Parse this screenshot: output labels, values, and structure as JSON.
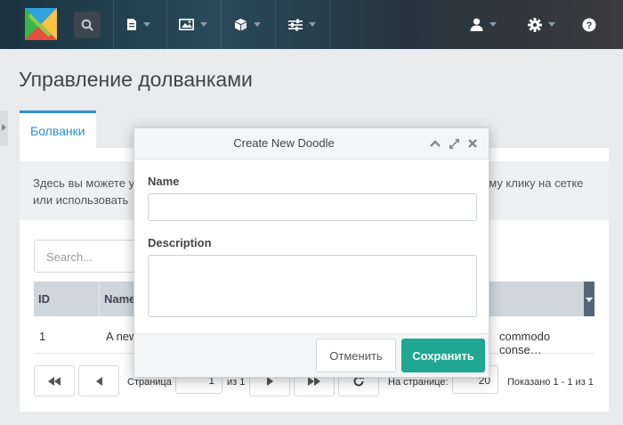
{
  "page": {
    "title": "Управление долванками"
  },
  "tabs": [
    {
      "label": "Болванки"
    }
  ],
  "info": {
    "line1_start": "Здесь вы можете у",
    "line1_end": "ому клику на сетке",
    "line2": "или использовать"
  },
  "grid": {
    "search_placeholder": "Search...",
    "columns": [
      {
        "label": "ID"
      },
      {
        "label": "Name"
      }
    ],
    "rows": [
      {
        "id": "1",
        "name": "A new",
        "tail": "commodo conse…"
      }
    ]
  },
  "pagination": {
    "page_label": "Страница",
    "page_value": "1",
    "of_label": "из 1",
    "per_page_label": "На странице:",
    "per_page_value": "20",
    "summary": "Показано 1 - 1 из 1"
  },
  "modal": {
    "title": "Create New Doodle",
    "name_label": "Name",
    "description_label": "Description",
    "cancel_label": "Отменить",
    "save_label": "Сохранить"
  },
  "colors": {
    "accent": "#2b8fd0",
    "save": "#1fa791",
    "grid_header": "#cfd7dd"
  },
  "icons": [
    "logo-icon",
    "search-icon",
    "document-icon",
    "image-icon",
    "cube-icon",
    "sliders-icon",
    "user-icon",
    "gear-icon",
    "help-icon"
  ]
}
